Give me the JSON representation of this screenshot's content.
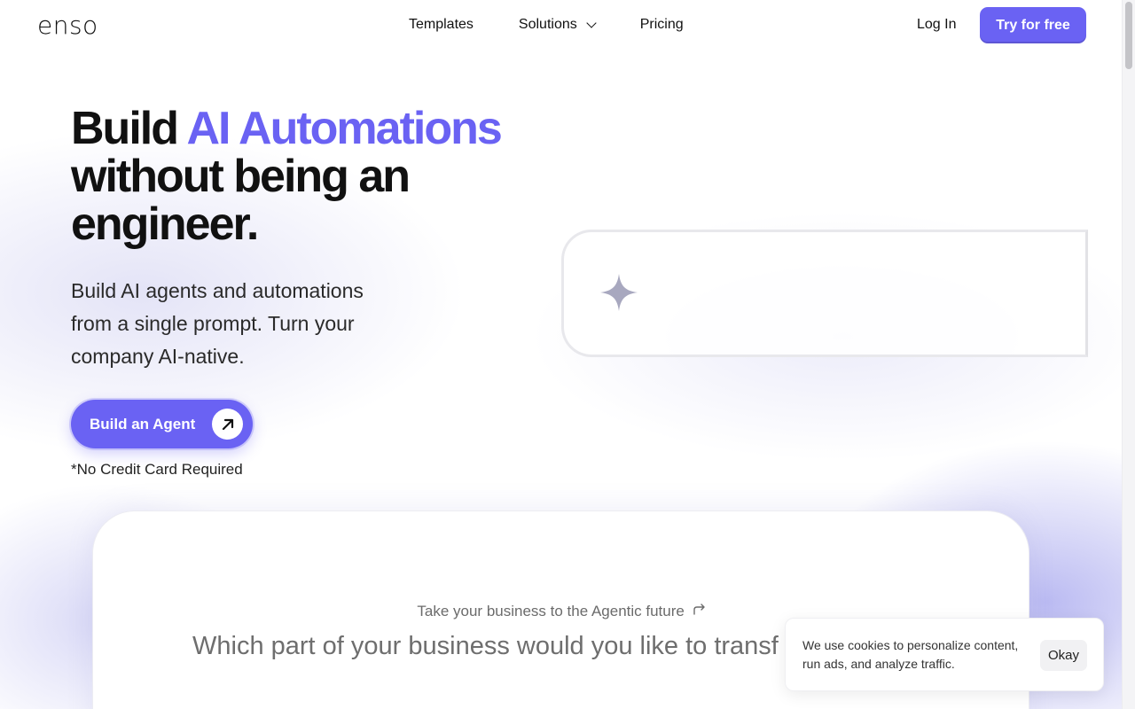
{
  "nav": {
    "logo": "enso",
    "links": [
      "Templates",
      "Solutions",
      "Pricing"
    ],
    "login": "Log In",
    "try_button": "Try for free"
  },
  "hero": {
    "title_part1": "Build ",
    "title_accent": "AI Automations",
    "title_line2": "without being an",
    "title_line3": "engineer.",
    "subtitle": "Build AI agents and automations from a single prompt. Turn your company AI-native.",
    "cta_label": "Build an Agent",
    "note": "*No Credit Card Required"
  },
  "card": {
    "kicker": "Take your business to the Agentic future",
    "question": "Which part of your business would you like to transf"
  },
  "cookie": {
    "text": "We use cookies to personalize content, run ads, and analyze traffic.",
    "button": "Okay"
  },
  "colors": {
    "accent": "#6a62f3",
    "text": "#111111",
    "muted": "#6e6e6e"
  },
  "icons": {
    "dropdown": "chevron-down-icon",
    "cta": "arrow-up-right-icon",
    "prompt": "sparkle-icon",
    "kicker": "forward-arrow-icon"
  }
}
